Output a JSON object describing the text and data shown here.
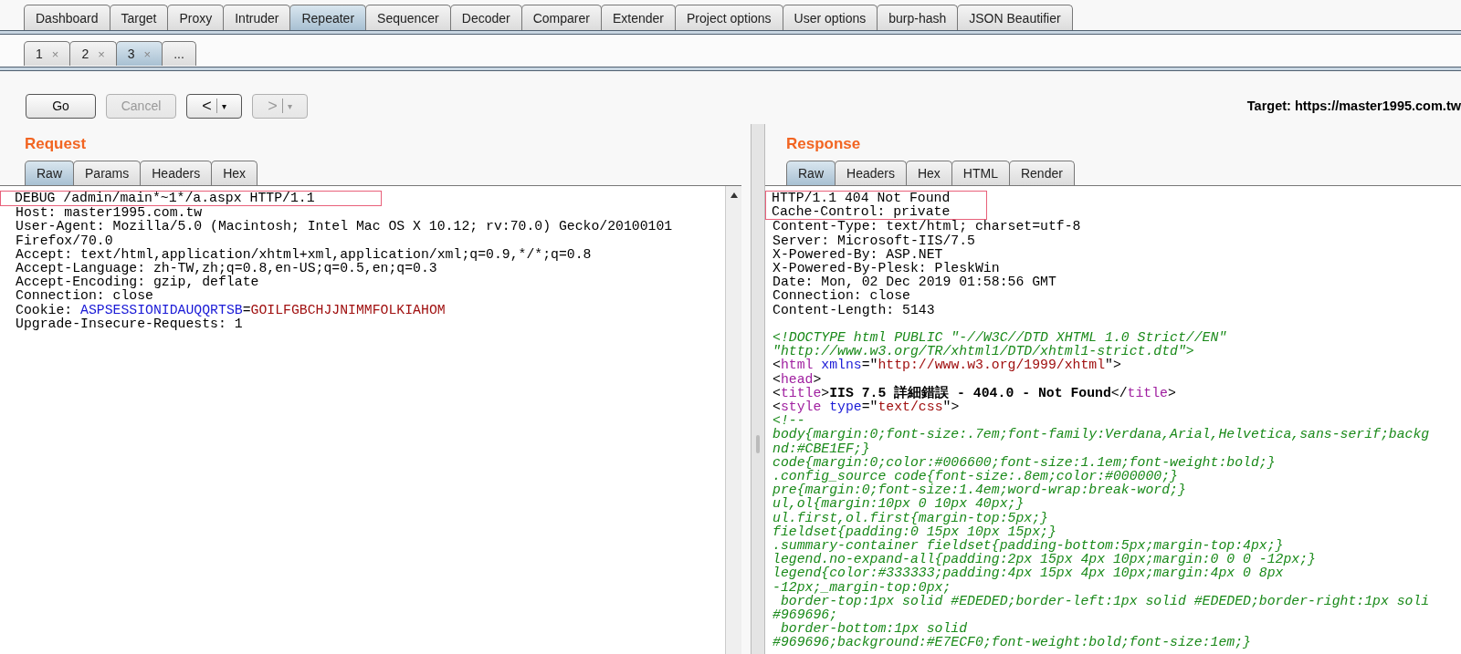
{
  "main_tabs": [
    {
      "label": "Dashboard",
      "selected": false
    },
    {
      "label": "Target",
      "selected": false
    },
    {
      "label": "Proxy",
      "selected": false
    },
    {
      "label": "Intruder",
      "selected": false
    },
    {
      "label": "Repeater",
      "selected": true
    },
    {
      "label": "Sequencer",
      "selected": false
    },
    {
      "label": "Decoder",
      "selected": false
    },
    {
      "label": "Comparer",
      "selected": false
    },
    {
      "label": "Extender",
      "selected": false
    },
    {
      "label": "Project options",
      "selected": false
    },
    {
      "label": "User options",
      "selected": false
    },
    {
      "label": "burp-hash",
      "selected": false
    },
    {
      "label": "JSON Beautifier",
      "selected": false
    }
  ],
  "repeater_tabs": [
    {
      "label": "1",
      "close": "×",
      "selected": false
    },
    {
      "label": "2",
      "close": "×",
      "selected": false
    },
    {
      "label": "3",
      "close": "×",
      "selected": true
    },
    {
      "label": "...",
      "selected": false
    }
  ],
  "toolbar": {
    "buttons": [
      {
        "kind": "text",
        "label": "Go",
        "disabled": false
      },
      {
        "kind": "text",
        "label": "Cancel",
        "disabled": true
      },
      {
        "kind": "history",
        "label": "<",
        "caret": "▾",
        "disabled": false
      },
      {
        "kind": "history",
        "label": ">",
        "caret": "▾",
        "disabled": true
      }
    ],
    "target": "Target: https://master1995.com.tw"
  },
  "request": {
    "title": "Request",
    "tabs": [
      {
        "label": "Raw",
        "selected": true
      },
      {
        "label": "Params",
        "selected": false
      },
      {
        "label": "Headers",
        "selected": false
      },
      {
        "label": "Hex",
        "selected": false
      }
    ],
    "lines": [
      {
        "highlighted": true,
        "segments": [
          {
            "kind": "text",
            "text": "DEBUG /admin/main*~1*/a.aspx HTTP/1.1"
          }
        ]
      },
      {
        "highlighted": false,
        "segments": [
          {
            "kind": "text",
            "text": "Host: master1995.com.tw"
          }
        ]
      },
      {
        "highlighted": false,
        "segments": [
          {
            "kind": "text",
            "text": "User-Agent: Mozilla/5.0 (Macintosh; Intel Mac OS X 10.12; rv:70.0) Gecko/20100101"
          }
        ]
      },
      {
        "highlighted": false,
        "segments": [
          {
            "kind": "text",
            "text": "Firefox/70.0"
          }
        ]
      },
      {
        "highlighted": false,
        "segments": [
          {
            "kind": "text",
            "text": "Accept: text/html,application/xhtml+xml,application/xml;q=0.9,*/*;q=0.8"
          }
        ]
      },
      {
        "highlighted": false,
        "segments": [
          {
            "kind": "text",
            "text": "Accept-Language: zh-TW,zh;q=0.8,en-US;q=0.5,en;q=0.3"
          }
        ]
      },
      {
        "highlighted": false,
        "segments": [
          {
            "kind": "text",
            "text": "Accept-Encoding: gzip, deflate"
          }
        ]
      },
      {
        "highlighted": false,
        "segments": [
          {
            "kind": "text",
            "text": "Connection: close"
          }
        ]
      },
      {
        "highlighted": false,
        "segments": [
          {
            "kind": "text",
            "text": "Cookie: "
          },
          {
            "kind": "name",
            "text": "ASPSESSIONIDAUQQRTSB"
          },
          {
            "kind": "text",
            "text": "="
          },
          {
            "kind": "value",
            "text": "GOILFGBCHJJNIMMFOLKIAHOM"
          }
        ]
      },
      {
        "highlighted": false,
        "segments": [
          {
            "kind": "text",
            "text": "Upgrade-Insecure-Requests: 1"
          }
        ]
      }
    ]
  },
  "response": {
    "title": "Response",
    "tabs": [
      {
        "label": "Raw",
        "selected": true
      },
      {
        "label": "Headers",
        "selected": false
      },
      {
        "label": "Hex",
        "selected": false
      },
      {
        "label": "HTML",
        "selected": false
      },
      {
        "label": "Render",
        "selected": false
      }
    ],
    "lines": [
      {
        "highlighted": true,
        "segments": [
          {
            "kind": "text",
            "text": "HTTP/1.1 404 Not Found"
          }
        ]
      },
      {
        "highlighted": true,
        "segments": [
          {
            "kind": "text",
            "text": "Cache-Control: private"
          }
        ]
      },
      {
        "highlighted": false,
        "segments": [
          {
            "kind": "text",
            "text": "Content-Type: text/html; charset=utf-8"
          }
        ]
      },
      {
        "highlighted": false,
        "segments": [
          {
            "kind": "text",
            "text": "Server: Microsoft-IIS/7.5"
          }
        ]
      },
      {
        "highlighted": false,
        "segments": [
          {
            "kind": "text",
            "text": "X-Powered-By: ASP.NET"
          }
        ]
      },
      {
        "highlighted": false,
        "segments": [
          {
            "kind": "text",
            "text": "X-Powered-By-Plesk: PleskWin"
          }
        ]
      },
      {
        "highlighted": false,
        "segments": [
          {
            "kind": "text",
            "text": "Date: Mon, 02 Dec 2019 01:58:56 GMT"
          }
        ]
      },
      {
        "highlighted": false,
        "segments": [
          {
            "kind": "text",
            "text": "Connection: close"
          }
        ]
      },
      {
        "highlighted": false,
        "segments": [
          {
            "kind": "text",
            "text": "Content-Length: 5143"
          }
        ]
      },
      {
        "highlighted": false
      },
      {
        "highlighted": false,
        "segments": [
          {
            "kind": "comment",
            "text": "<!DOCTYPE html PUBLIC \"-//W3C//DTD XHTML 1.0 Strict//EN\""
          }
        ]
      },
      {
        "highlighted": false,
        "segments": [
          {
            "kind": "comment",
            "text": "\"http://www.w3.org/TR/xhtml1/DTD/xhtml1-strict.dtd\">"
          }
        ]
      },
      {
        "highlighted": false,
        "segments": [
          {
            "kind": "text",
            "text": "<"
          },
          {
            "kind": "tag",
            "text": "html"
          },
          {
            "kind": "name",
            "text": " xmlns"
          },
          {
            "kind": "text",
            "text": "=\""
          },
          {
            "kind": "value",
            "text": "http://www.w3.org/1999/xhtml"
          },
          {
            "kind": "text",
            "text": "\">"
          }
        ]
      },
      {
        "highlighted": false,
        "segments": [
          {
            "kind": "text",
            "text": "<"
          },
          {
            "kind": "tag",
            "text": "head"
          },
          {
            "kind": "text",
            "text": ">"
          }
        ]
      },
      {
        "highlighted": false,
        "segments": [
          {
            "kind": "text",
            "text": "<"
          },
          {
            "kind": "tag",
            "text": "title"
          },
          {
            "kind": "text",
            "text": ">"
          },
          {
            "kind": "bold",
            "text": "IIS 7.5 詳細錯誤 - 404.0 - Not Found"
          },
          {
            "kind": "text",
            "text": "</"
          },
          {
            "kind": "tag",
            "text": "title"
          },
          {
            "kind": "text",
            "text": ">"
          }
        ]
      },
      {
        "highlighted": false,
        "segments": [
          {
            "kind": "text",
            "text": "<"
          },
          {
            "kind": "tag",
            "text": "style"
          },
          {
            "kind": "name",
            "text": " type"
          },
          {
            "kind": "text",
            "text": "=\""
          },
          {
            "kind": "value",
            "text": "text/css"
          },
          {
            "kind": "text",
            "text": "\">"
          }
        ]
      },
      {
        "highlighted": false,
        "segments": [
          {
            "kind": "comment",
            "text": "<!--"
          }
        ]
      },
      {
        "highlighted": false,
        "segments": [
          {
            "kind": "comment",
            "text": "body{margin:0;font-size:.7em;font-family:Verdana,Arial,Helvetica,sans-serif;backg"
          }
        ]
      },
      {
        "highlighted": false,
        "segments": [
          {
            "kind": "comment",
            "text": "nd:#CBE1EF;}"
          }
        ]
      },
      {
        "highlighted": false,
        "segments": [
          {
            "kind": "comment",
            "text": "code{margin:0;color:#006600;font-size:1.1em;font-weight:bold;}"
          }
        ]
      },
      {
        "highlighted": false,
        "segments": [
          {
            "kind": "comment",
            "text": ".config_source code{font-size:.8em;color:#000000;}"
          }
        ]
      },
      {
        "highlighted": false,
        "segments": [
          {
            "kind": "comment",
            "text": "pre{margin:0;font-size:1.4em;word-wrap:break-word;}"
          }
        ]
      },
      {
        "highlighted": false,
        "segments": [
          {
            "kind": "comment",
            "text": "ul,ol{margin:10px 0 10px 40px;}"
          }
        ]
      },
      {
        "highlighted": false,
        "segments": [
          {
            "kind": "comment",
            "text": "ul.first,ol.first{margin-top:5px;}"
          }
        ]
      },
      {
        "highlighted": false,
        "segments": [
          {
            "kind": "comment",
            "text": "fieldset{padding:0 15px 10px 15px;}"
          }
        ]
      },
      {
        "highlighted": false,
        "segments": [
          {
            "kind": "comment",
            "text": ".summary-container fieldset{padding-bottom:5px;margin-top:4px;}"
          }
        ]
      },
      {
        "highlighted": false,
        "segments": [
          {
            "kind": "comment",
            "text": "legend.no-expand-all{padding:2px 15px 4px 10px;margin:0 0 0 -12px;}"
          }
        ]
      },
      {
        "highlighted": false,
        "segments": [
          {
            "kind": "comment",
            "text": "legend{color:#333333;padding:4px 15px 4px 10px;margin:4px 0 8px"
          }
        ]
      },
      {
        "highlighted": false,
        "segments": [
          {
            "kind": "comment",
            "text": "-12px;_margin-top:0px;"
          }
        ]
      },
      {
        "highlighted": false,
        "segments": [
          {
            "kind": "comment",
            "text": " border-top:1px solid #EDEDED;border-left:1px solid #EDEDED;border-right:1px soli"
          }
        ]
      },
      {
        "highlighted": false,
        "segments": [
          {
            "kind": "comment",
            "text": "#969696;"
          }
        ]
      },
      {
        "highlighted": false,
        "segments": [
          {
            "kind": "comment",
            "text": " border-bottom:1px solid"
          }
        ]
      },
      {
        "highlighted": false,
        "segments": [
          {
            "kind": "comment",
            "text": "#969696;background:#E7ECF0;font-weight:bold;font-size:1em;}"
          }
        ]
      }
    ]
  }
}
